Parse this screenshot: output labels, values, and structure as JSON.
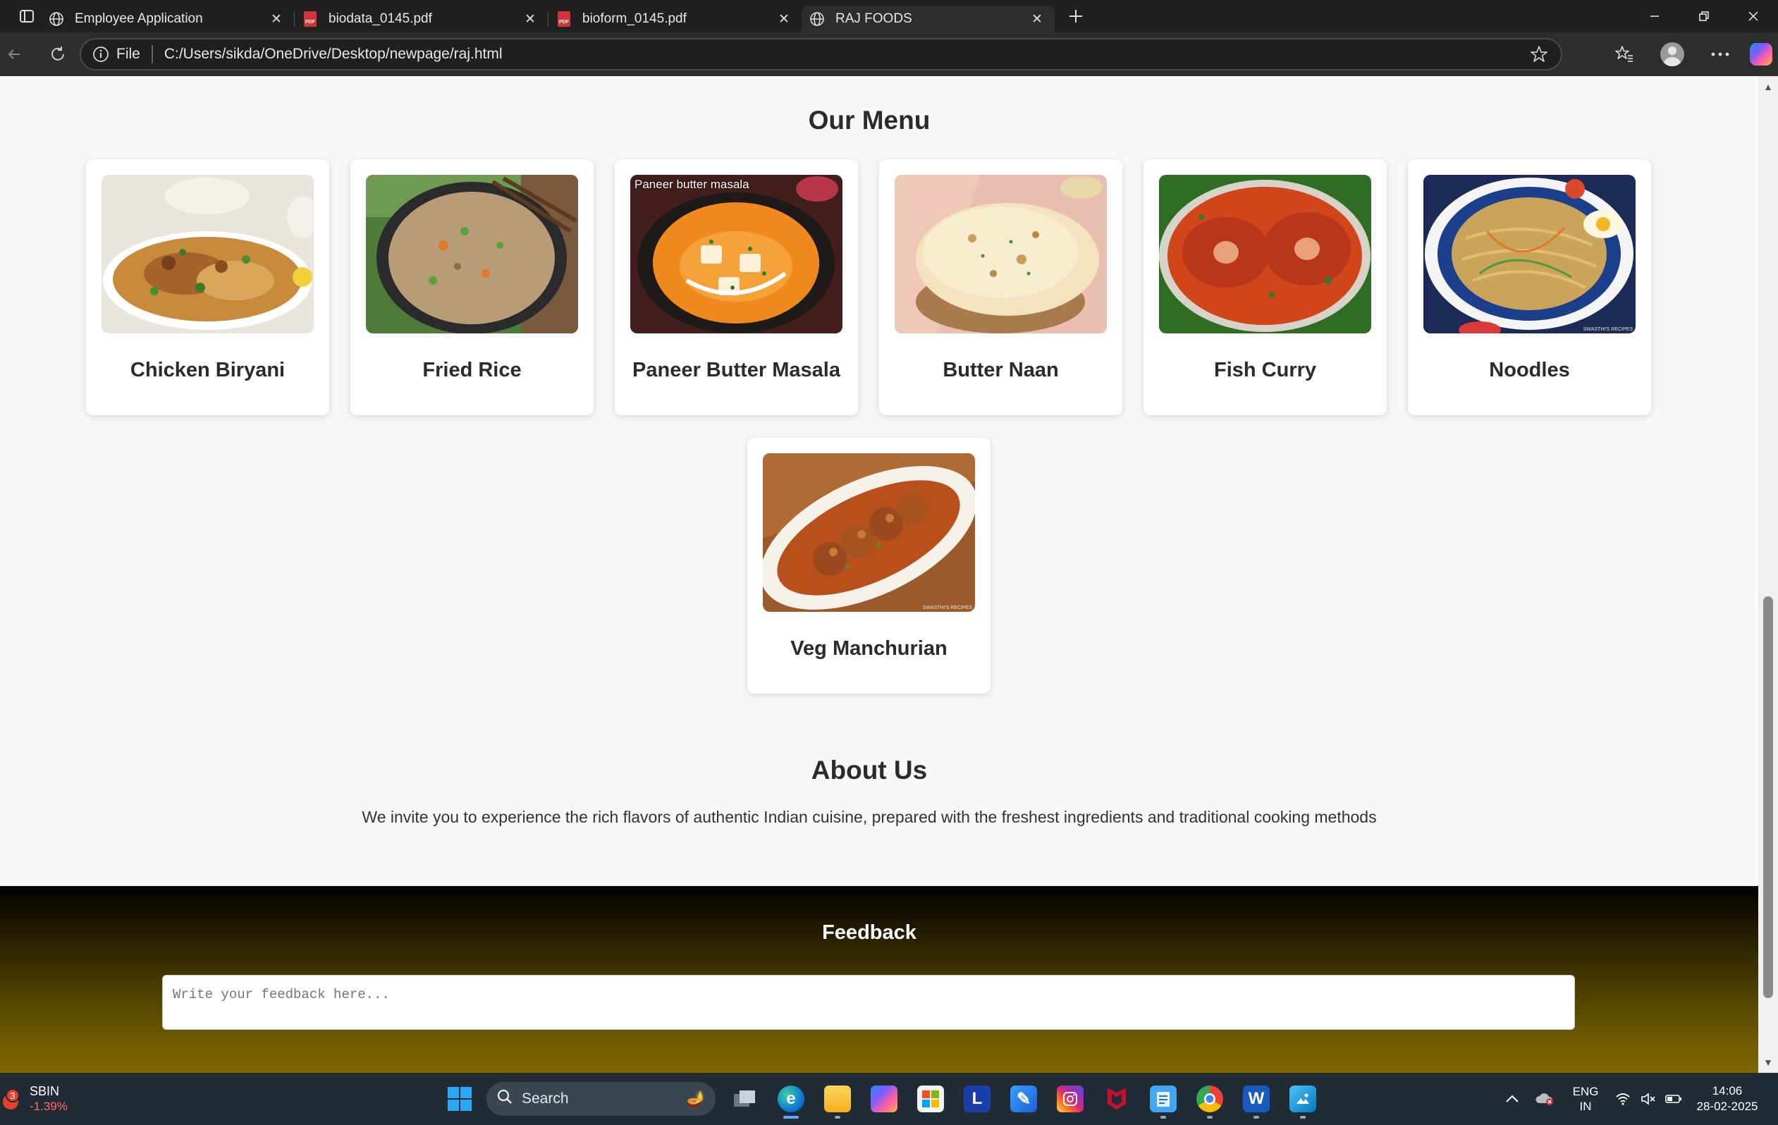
{
  "browser": {
    "tabs": [
      {
        "label": "Employee Application",
        "icon": "globe-icon",
        "active": false
      },
      {
        "label": "biodata_0145.pdf",
        "icon": "pdf-icon",
        "active": false
      },
      {
        "label": "bioform_0145.pdf",
        "icon": "pdf-icon",
        "active": false
      },
      {
        "label": "RAJ FOODS",
        "icon": "globe-icon",
        "active": true
      }
    ],
    "address": {
      "scheme_label": "File",
      "url": "C:/Users/sikda/OneDrive/Desktop/newpage/raj.html"
    }
  },
  "page": {
    "menu": {
      "title": "Our Menu",
      "items": [
        {
          "name": "Chicken Biryani",
          "image_caption": ""
        },
        {
          "name": "Fried Rice",
          "image_caption": ""
        },
        {
          "name": "Paneer Butter Masala",
          "image_caption": "Paneer butter masala"
        },
        {
          "name": "Butter Naan",
          "image_caption": ""
        },
        {
          "name": "Fish Curry",
          "image_caption": ""
        },
        {
          "name": "Noodles",
          "image_caption": ""
        },
        {
          "name": "Veg Manchurian",
          "image_caption": ""
        }
      ]
    },
    "about": {
      "title": "About Us",
      "text": "We invite you to experience the rich flavors of authentic Indian cuisine, prepared with the freshest ingredients and traditional cooking methods"
    },
    "footer": {
      "title": "Feedback",
      "feedback_placeholder": "Write your feedback here..."
    }
  },
  "taskbar": {
    "stock": {
      "badge": "3",
      "symbol": "SBIN",
      "change": "-1.39%"
    },
    "search_label": "Search",
    "apps": [
      "file-explorer-icon",
      "edge-icon",
      "folder-icon",
      "copilot-icon",
      "store-icon",
      "l-app-icon",
      "paint-icon",
      "instagram-icon",
      "mcafee-icon",
      "notepad-icon",
      "chrome-icon",
      "word-icon",
      "photos-icon"
    ],
    "language": {
      "line1": "ENG",
      "line2": "IN"
    },
    "time": "14:06",
    "date": "28-02-2025"
  },
  "colors": {
    "accent": "#0078d4",
    "footer_gradient_start": "#000000",
    "footer_gradient_end": "#7d6800",
    "stock_negative": "#ff6b6b"
  }
}
